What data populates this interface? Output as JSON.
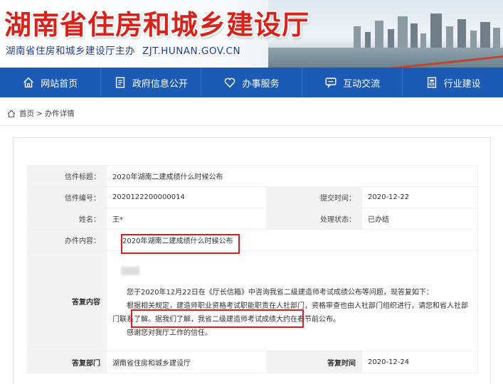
{
  "header": {
    "site_title": "湖南省住房和城乡建设厅",
    "subtitle": "湖南省住房和城乡建设厅主办",
    "url": "ZJT.HUNAN.GOV.CN"
  },
  "nav": {
    "items": [
      {
        "label": "网站首页",
        "icon": "home-icon"
      },
      {
        "label": "政府信息公开",
        "icon": "document-icon"
      },
      {
        "label": "办事服务",
        "icon": "heart-icon"
      },
      {
        "label": "互动交流",
        "icon": "chat-icon"
      },
      {
        "label": "行业建设",
        "icon": "building-icon"
      }
    ]
  },
  "breadcrumb": {
    "home": "首页",
    "separator": ">",
    "current": "办件详情"
  },
  "letter": {
    "title_label": "信件标题：",
    "title_value": "2020年湖南二建成绩什么时候公布",
    "number_label": "信件编号：",
    "number_value": "2020122200000014",
    "submit_time_label": "提交时间：",
    "submit_time_value": "2020-12-22",
    "name_label": "姓名：",
    "name_value": "王*",
    "status_label": "处理状态：",
    "status_value": "已办结",
    "content_label": "办件内容：",
    "content_value": "2020年湖南二建成绩什么时候公布",
    "reply_label": "答复内容",
    "reply_paragraphs": [
      "您于2020年12月22日在《厅长信箱》中咨询我省二级建造师考试成绩公布等问题，现答复如下：",
      "根据相关规定，建造师职业资格考试职能职责在人社部门，资格审查也由人社部门组织进行，请您和省人社部门联系了解。据我们了解，我省二级建造师考试成绩大约在春节前公布。",
      "感谢您对我厅工作的信任。"
    ],
    "reply_dept_label": "答复部门",
    "reply_dept_value": "湖南省住房和城乡建设厅",
    "reply_time_label": "答复时间",
    "reply_time_value": "2020-12-24"
  },
  "colors": {
    "title_red": "#d8231c",
    "nav_blue": "#1c5bb5",
    "highlight_red": "#d81e1e",
    "subtitle_blue": "#1f3f9a"
  }
}
